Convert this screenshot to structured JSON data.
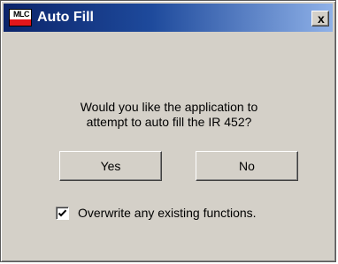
{
  "window": {
    "title": "Auto Fill",
    "logo_text": "MLC",
    "close_glyph": "x"
  },
  "dialog": {
    "message_line1": "Would you like the application to",
    "message_line2": "attempt to auto fill the IR 452?",
    "yes_label": "Yes",
    "no_label": "No",
    "checkbox_label": "Overwrite any existing functions.",
    "checkbox_checked": true
  },
  "colors": {
    "title_gradient_start": "#0b246a",
    "title_gradient_end": "#8fb1e8",
    "dialog_face": "#d4d0c8",
    "logo_accent": "#e3161b"
  },
  "icons": {
    "app": "mlc-logo-icon",
    "close": "close-icon",
    "check": "checkmark-icon"
  }
}
